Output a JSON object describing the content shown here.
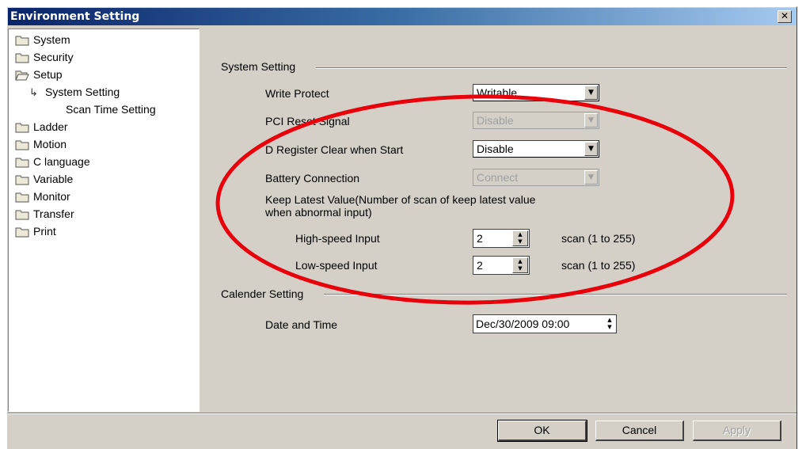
{
  "window": {
    "title": "Environment Setting",
    "close_label": "✕"
  },
  "tree": {
    "items": [
      {
        "label": "System"
      },
      {
        "label": "Security"
      },
      {
        "label": "Setup"
      },
      {
        "label": "System Setting"
      },
      {
        "label": "Scan Time Setting"
      },
      {
        "label": "Ladder"
      },
      {
        "label": "Motion"
      },
      {
        "label": "C language"
      },
      {
        "label": "Variable"
      },
      {
        "label": "Monitor"
      },
      {
        "label": "Transfer"
      },
      {
        "label": "Print"
      }
    ]
  },
  "system_setting": {
    "group_label": "System Setting",
    "write_protect_label": "Write Protect",
    "write_protect_value": "Writable",
    "pci_reset_label": "PCI Reset Signal",
    "pci_reset_value": "Disable",
    "d_register_label": "D Register Clear when Start",
    "d_register_value": "Disable",
    "battery_label": "Battery Connection",
    "battery_value": "Connect",
    "keep_latest_line1": "Keep Latest Value(Number of scan of keep latest value",
    "keep_latest_line2": "when abnormal input)",
    "high_speed_label": "High-speed Input",
    "high_speed_value": "2",
    "high_speed_unit": "scan (1 to 255)",
    "low_speed_label": "Low-speed Input",
    "low_speed_value": "2",
    "low_speed_unit": "scan (1 to 255)"
  },
  "calender_setting": {
    "group_label": "Calender Setting",
    "date_time_label": "Date and Time",
    "date_time_value": "Dec/30/2009 09:00"
  },
  "buttons": {
    "ok": "OK",
    "cancel": "Cancel",
    "apply": "Apply"
  },
  "colors": {
    "annotation_ellipse": "#e8000b",
    "titlebar_start": "#0a246a",
    "titlebar_end": "#a6caf0"
  }
}
